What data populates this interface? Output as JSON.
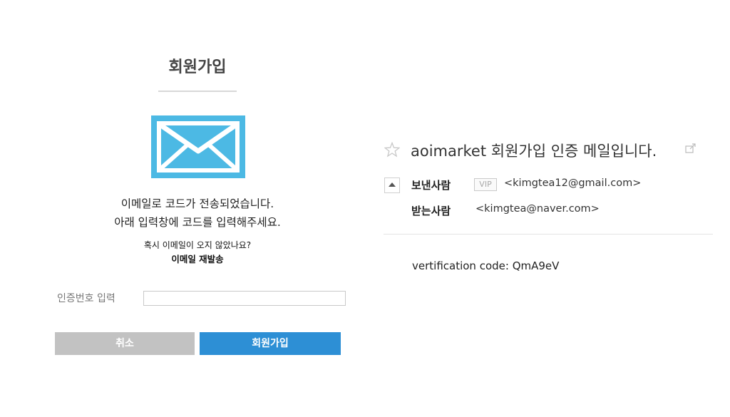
{
  "signup": {
    "title": "회원가입",
    "message_line1": "이메일로 코드가 전송되었습니다.",
    "message_line2": "아래 입력창에 코드를 입력해주세요.",
    "question": "혹시 이메일이 오지 않았나요?",
    "resend_link": "이메일 재발송",
    "code_label": "인증번호 입력",
    "code_value": "",
    "cancel_button": "취소",
    "signup_button": "회원가입",
    "envelope_icon": "mail-envelope-icon"
  },
  "mail": {
    "subject": "aoimarket 회원가입 인증 메일입니다.",
    "sender_label": "보낸사람",
    "vip_badge": "VIP",
    "sender_address": "<kimgtea12@gmail.com>",
    "recipient_label": "받는사람",
    "recipient_address": "<kimgtea@naver.com>",
    "body": "vertification code: QmA9eV",
    "icons": [
      "star-icon",
      "external-link-icon",
      "collapse-arrow-icon"
    ]
  },
  "colors": {
    "accent_blue": "#2d8fd5",
    "envelope_blue": "#4cb9e4",
    "cancel_gray": "#c2c2c2"
  }
}
